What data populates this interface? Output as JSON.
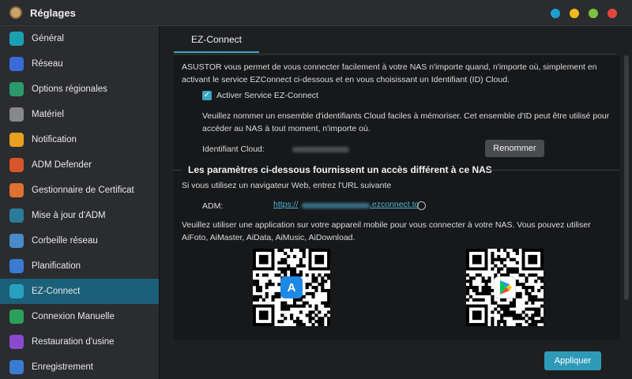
{
  "window": {
    "title": "Réglages",
    "controls": [
      {
        "name": "window-dot-blue",
        "color": "#1aa0d0"
      },
      {
        "name": "window-dot-yellow",
        "color": "#f0b91c"
      },
      {
        "name": "window-dot-green",
        "color": "#7cc242"
      },
      {
        "name": "window-dot-red",
        "color": "#e0473c"
      }
    ]
  },
  "sidebar": {
    "items": [
      {
        "label": "Général",
        "icon": "general-icon",
        "color": "#1aa0b0",
        "active": false
      },
      {
        "label": "Réseau",
        "icon": "network-icon",
        "color": "#3a6ad8",
        "active": false
      },
      {
        "label": "Options régionales",
        "icon": "globe-icon",
        "color": "#2a9a6a",
        "active": false
      },
      {
        "label": "Matériel",
        "icon": "hardware-icon",
        "color": "#888888",
        "active": false
      },
      {
        "label": "Notification",
        "icon": "notification-icon",
        "color": "#e8a020",
        "active": false
      },
      {
        "label": "ADM Defender",
        "icon": "firewall-icon",
        "color": "#d8542a",
        "active": false
      },
      {
        "label": "Gestionnaire de Certificat",
        "icon": "certificate-icon",
        "color": "#e07030",
        "active": false
      },
      {
        "label": "Mise à jour d'ADM",
        "icon": "update-icon",
        "color": "#2a7a9a",
        "active": false
      },
      {
        "label": "Corbeille réseau",
        "icon": "recycle-bin-icon",
        "color": "#4a8ac8",
        "active": false
      },
      {
        "label": "Planification",
        "icon": "calendar-icon",
        "color": "#3a7ad0",
        "active": false
      },
      {
        "label": "EZ-Connect",
        "icon": "cloud-icon",
        "color": "#2aa0c0",
        "active": true
      },
      {
        "label": "Connexion Manuelle",
        "icon": "manual-connect-icon",
        "color": "#2aa05a",
        "active": false
      },
      {
        "label": "Restauration d'usine",
        "icon": "factory-reset-icon",
        "color": "#8a4ad0",
        "active": false
      },
      {
        "label": "Enregistrement",
        "icon": "registration-icon",
        "color": "#3a7ad0",
        "active": false
      }
    ]
  },
  "main": {
    "tab": "EZ-Connect",
    "intro_line1": "ASUSTOR vous permet de vous connecter facilement à votre NAS n'importe quand, n'importe où, simplement en",
    "intro_line2": "activant le service EZConnect ci-dessous et en vous choisissant un Identifiant (ID) Cloud.",
    "enable_label": "Activer Service EZ-Connect",
    "enable_checked": true,
    "name_line1": "Veuillez nommer un ensemble d'identifiants Cloud faciles à mémoriser. Cet ensemble d'ID peut être utilisé pour",
    "name_line2": "accéder au NAS à tout moment, n'importe où.",
    "cloud_id_label": "Identifiant Cloud:",
    "rename_button": "Renommer",
    "section_title": "Les paramètres ci-dessous fournissent un accès différent à ce NAS",
    "browser_line": "Si vous utilisez un navigateur Web, entrez l'URL suivante",
    "adm_label": "ADM:",
    "adm_url_prefix": "https://",
    "adm_url_suffix": ".ezconnect.to",
    "mobile_line1": "Veuillez utiliser une application sur votre appareil mobile pour vous connecter à votre NAS. Vous pouvez utiliser",
    "mobile_line2": "AiFoto, AiMaster, AiData, AiMusic, AiDownload.",
    "qr_appstore_icon": "app-store-icon",
    "qr_playstore_icon": "google-play-icon",
    "apply_button": "Appliquer"
  }
}
